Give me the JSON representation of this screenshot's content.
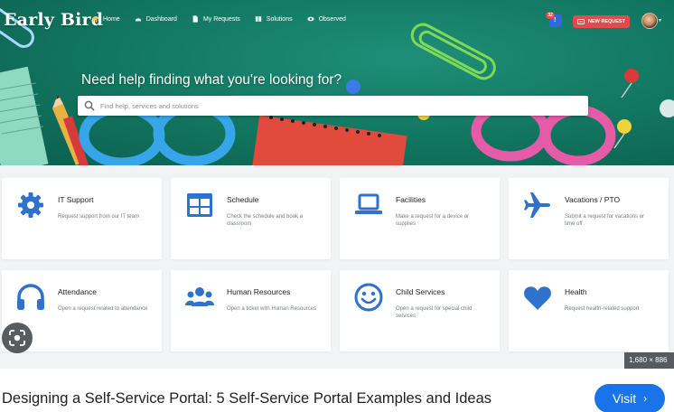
{
  "app": {
    "logo_text": "Early Bird",
    "nav": [
      {
        "label": "Home",
        "icon": "home-icon"
      },
      {
        "label": "Dashboard",
        "icon": "dashboard-icon"
      },
      {
        "label": "My Requests",
        "icon": "document-icon"
      },
      {
        "label": "Solutions",
        "icon": "book-icon"
      },
      {
        "label": "Observed",
        "icon": "eye-icon"
      }
    ],
    "notifications": {
      "count": "32",
      "icon": "notification-icon"
    },
    "new_request_label": "NEW REQUEST",
    "avatar_caret": "▾"
  },
  "hero": {
    "title": "Need help finding what you're looking for?",
    "search_placeholder": "Find help, services and solutions"
  },
  "cards": [
    {
      "title": "IT Support",
      "desc": "Request support from our IT team",
      "icon": "gear-icon"
    },
    {
      "title": "Schedule",
      "desc": "Check the schedule and book a classroom",
      "icon": "schedule-grid-icon"
    },
    {
      "title": "Facilities",
      "desc": "Make a request for a device or supplies",
      "icon": "laptop-icon"
    },
    {
      "title": "Vacations / PTO",
      "desc": "Submit a request for vacations or time off",
      "icon": "airplane-icon"
    },
    {
      "title": "Attendance",
      "desc": "Open a request related to attendance",
      "icon": "headphones-icon"
    },
    {
      "title": "Human Resources",
      "desc": "Open a ticket with Human Resources",
      "icon": "people-icon"
    },
    {
      "title": "Child Services",
      "desc": "Open a request for special child services",
      "icon": "smiley-icon"
    },
    {
      "title": "Health",
      "desc": "Request health-related support",
      "icon": "heart-icon"
    }
  ],
  "colors": {
    "accent_blue": "#2f72cc",
    "hero_green": "#137a64",
    "new_request_red": "#e04c4c"
  },
  "image_overlay": {
    "dimensions": "1,680 × 886"
  },
  "result": {
    "caption": "Designing a Self-Service Portal: 5 Self-Service Portal Examples and Ideas",
    "visit_label": "Visit"
  }
}
